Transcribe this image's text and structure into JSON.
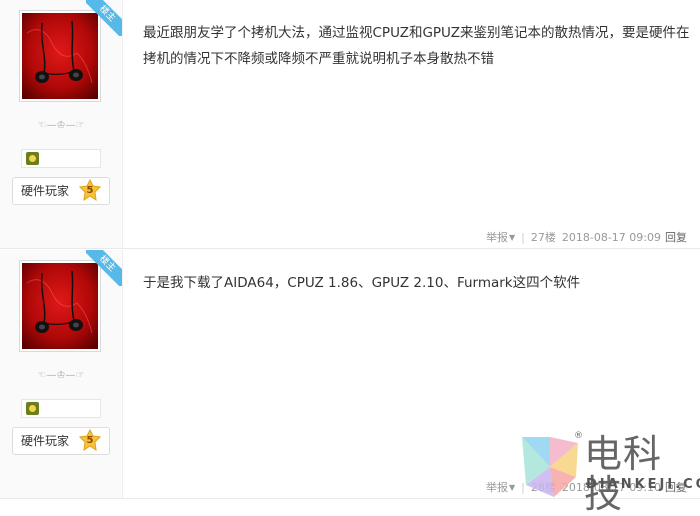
{
  "posts": [
    {
      "badge": "楼主",
      "signature": "☜—♔—☞",
      "role": "硬件玩家",
      "level": "5",
      "content": "最近跟朋友学了个拷机大法，通过监视CPUZ和GPUZ来鉴别笔记本的散热情况，要是硬件在拷机的情况下不降频或降频不严重就说明机子本身散热不错",
      "report": "举报",
      "floor": "27楼",
      "time": "2018-08-17 09:09",
      "reply": "回复"
    },
    {
      "badge": "楼主",
      "signature": "☜—♔—☞",
      "role": "硬件玩家",
      "level": "5",
      "content": "于是我下载了AIDA64，CPUZ 1.86、GPUZ 2.10、Furmark这四个软件",
      "report": "举报",
      "floor": "28楼",
      "time": "2018-08-17 09:10",
      "reply": "回复"
    }
  ],
  "watermark": {
    "title": "电科技",
    "subtitle": "DIANKEJI.COM",
    "reg": "®"
  },
  "colors": {
    "accent": "#57b9e8",
    "sidebar_bg": "#fafafa",
    "text": "#333333",
    "meta": "#999999"
  }
}
